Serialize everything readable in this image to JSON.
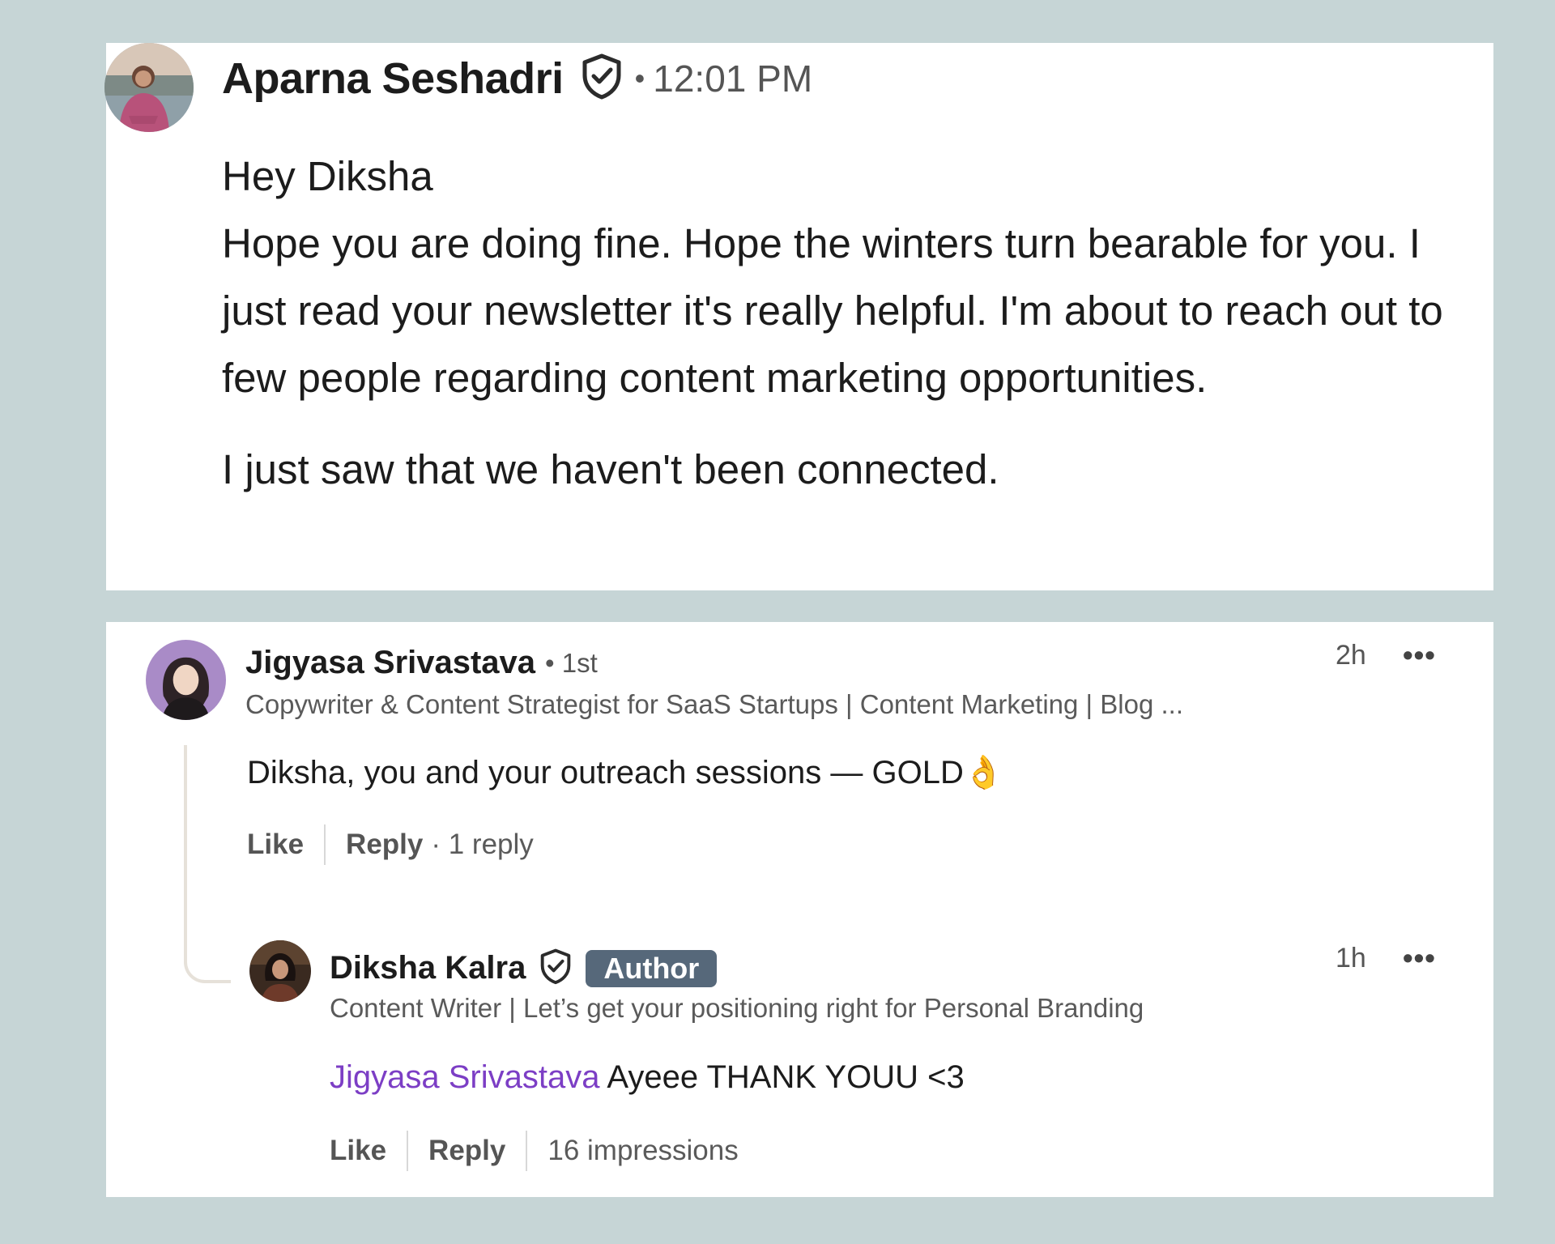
{
  "message": {
    "sender_name": "Aparna Seshadri",
    "time": "12:01 PM",
    "bullet": "•",
    "lines": [
      "Hey Diksha",
      "Hope you are doing fine. Hope the winters turn bearable for you. I just read your newsletter it's really helpful. I'm about to reach out to few people regarding content marketing opportunities."
    ],
    "second_paragraph": "I just saw that we haven't been connected."
  },
  "comment": {
    "name": "Jigyasa Srivastava",
    "degree": "• 1st",
    "headline": "Copywriter & Content Strategist for SaaS Startups | Content Marketing | Blog ...",
    "time": "2h",
    "more": "•••",
    "text": "Diksha, you and your outreach sessions — GOLD👌",
    "actions": {
      "like": "Like",
      "reply": "Reply",
      "reply_count": "· 1 reply"
    }
  },
  "reply": {
    "name": "Diksha Kalra",
    "badge": "Author",
    "headline": "Content Writer | Let’s get your positioning right for Personal Branding",
    "time": "1h",
    "more": "•••",
    "mention": "Jigyasa Srivastava",
    "text": "Ayeee THANK YOUU <3",
    "actions": {
      "like": "Like",
      "reply": "Reply",
      "impressions": "16 impressions"
    }
  },
  "colors": {
    "background": "#c6d5d6",
    "card": "#ffffff",
    "author_badge": "#56687a",
    "mention": "#7c3ec5"
  },
  "icons": [
    "verified-shield-icon",
    "more-options-icon"
  ]
}
